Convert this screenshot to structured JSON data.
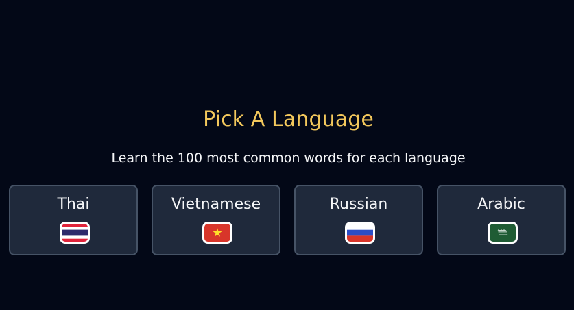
{
  "header": {
    "title": "Pick A Language",
    "subtitle": "Learn the 100 most common words for each language"
  },
  "languages": [
    {
      "label": "Thai",
      "flag_icon": "thailand-flag-icon"
    },
    {
      "label": "Vietnamese",
      "flag_icon": "vietnam-flag-icon"
    },
    {
      "label": "Russian",
      "flag_icon": "russia-flag-icon"
    },
    {
      "label": "Arabic",
      "flag_icon": "saudi-arabia-flag-icon"
    }
  ],
  "colors": {
    "background": "#030817",
    "title": "#f3c85c",
    "card_bg": "#1f293b",
    "card_border": "#465366",
    "text": "#f5f6f8"
  }
}
